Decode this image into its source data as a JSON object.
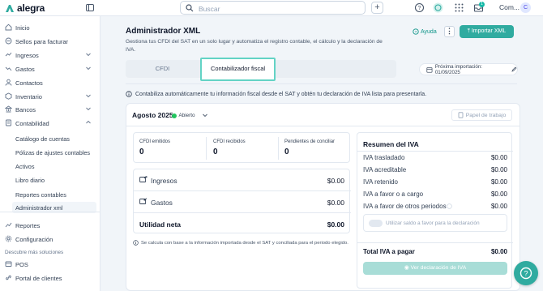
{
  "app": {
    "brand": "alegra",
    "company_short": "Com...",
    "avatar_initial": "C",
    "notification_count": "1",
    "accent": "#30aba0"
  },
  "search": {
    "placeholder": "Buscar"
  },
  "sidebar": {
    "items": [
      {
        "label": "Inicio",
        "icon": "home-icon"
      },
      {
        "label": "Sellos para facturar",
        "icon": "stamp-icon"
      },
      {
        "label": "Ingresos",
        "icon": "income-icon"
      },
      {
        "label": "Gastos",
        "icon": "expenses-icon"
      },
      {
        "label": "Contactos",
        "icon": "contacts-icon"
      },
      {
        "label": "Inventario",
        "icon": "inventory-icon"
      },
      {
        "label": "Bancos",
        "icon": "bank-icon"
      },
      {
        "label": "Contabilidad",
        "icon": "accounting-icon"
      }
    ],
    "contabilidad_sub": [
      "Catálogo de cuentas",
      "Pólizas de ajustes contables",
      "Activos",
      "Libro diario",
      "Reportes contables",
      "Administrador xml"
    ],
    "bottom": [
      {
        "label": "Reportes",
        "icon": "reports-icon"
      },
      {
        "label": "Configuración",
        "icon": "settings-icon"
      }
    ],
    "discover_title": "Descubre más soluciones",
    "discover": [
      {
        "label": "POS",
        "icon": "pos-icon"
      },
      {
        "label": "Portal de clientes",
        "icon": "portal-icon"
      }
    ]
  },
  "header": {
    "title": "Administrador XML",
    "description": "Gestiona tus CFDI del SAT en un solo lugar y automatiza el registro contable, el cálculo y la declaración de IVA.",
    "help_label": "Ayuda",
    "import_label": "Importar XML"
  },
  "tabs": [
    {
      "label": "CFDI",
      "active": false
    },
    {
      "label": "Contabilizador fiscal",
      "active": true
    }
  ],
  "next_import": "Próxima importación: 01/09/2025",
  "info_text": "Contabiliza automáticamente tu información fiscal desde el SAT y obtén tu declaración de IVA lista para presentarla.",
  "period": {
    "label": "Agosto 2025",
    "status": "Abierto",
    "worksheet_label": "Papel de trabajo"
  },
  "stats": [
    {
      "label": "CFDI emitidos",
      "value": "0"
    },
    {
      "label": "CFDI recibidos",
      "value": "0"
    },
    {
      "label": "Pendientes de conciliar",
      "value": "0"
    }
  ],
  "ledger": {
    "income_label": "Ingresos",
    "income_value": "$0.00",
    "expenses_label": "Gastos",
    "expenses_value": "$0.00",
    "net_label": "Utilidad neta",
    "net_value": "$0.00"
  },
  "footnote": "Se calcula con base a la información importada desde el SAT y conciliada para el periodo elegido.",
  "iva": {
    "title": "Resumen del IVA",
    "rows": [
      {
        "label": "IVA trasladado",
        "value": "$0.00"
      },
      {
        "label": "IVA acreditable",
        "value": "$0.00"
      },
      {
        "label": "IVA retenido",
        "value": "$0.00"
      },
      {
        "label": "IVA a favor o a cargo",
        "value": "$0.00"
      },
      {
        "label": "IVA a favor de otros periodos",
        "value": "$0.00"
      }
    ],
    "use_balance_label": "Utilizar saldo a favor para la declaración",
    "total_label": "Total IVA a pagar",
    "total_value": "$0.00",
    "view_button": "Ver declaración de IVA"
  }
}
